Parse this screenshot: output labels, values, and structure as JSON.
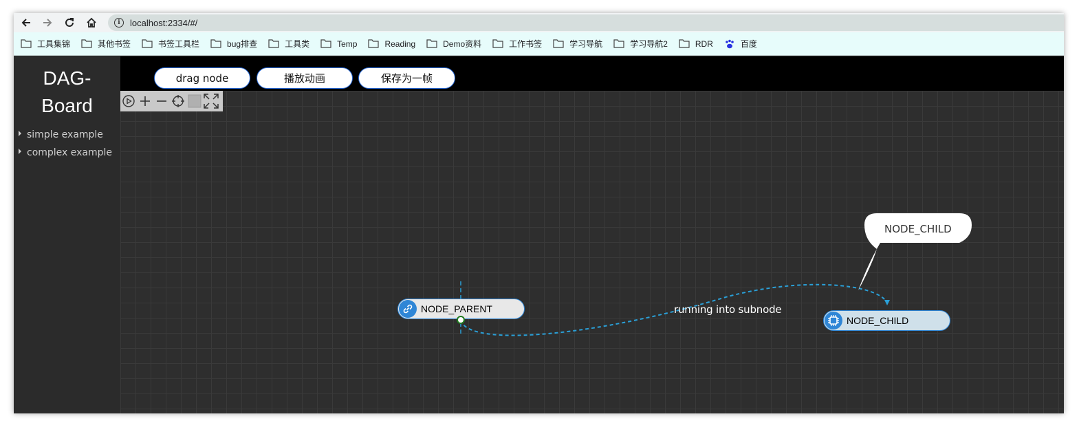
{
  "browser": {
    "url": "localhost:2334/#/",
    "bookmarks": [
      "工具集锦",
      "其他书签",
      "书签工具栏",
      "bug排查",
      "工具类",
      "Temp",
      "Reading",
      "Demo资料",
      "工作书签",
      "学习导航",
      "学习导航2",
      "RDR",
      "百度"
    ]
  },
  "sidebar": {
    "brand_line1": "DAG-",
    "brand_line2": "Board",
    "items": [
      {
        "label": "simple example"
      },
      {
        "label": "complex example"
      }
    ]
  },
  "topbar": {
    "buttons": [
      {
        "label": "drag node"
      },
      {
        "label": "播放动画"
      },
      {
        "label": "保存为一帧"
      }
    ]
  },
  "canvas": {
    "nodes": [
      {
        "label": "NODE_PARENT",
        "icon": "link-icon",
        "color": "#e8e8e8"
      },
      {
        "label": "NODE_CHILD",
        "icon": "chip-icon",
        "color": "#cfe0ea"
      }
    ],
    "edge_label": "running into subnode",
    "tooltip_label": "NODE_CHILD",
    "accent": "#2f86d6"
  }
}
